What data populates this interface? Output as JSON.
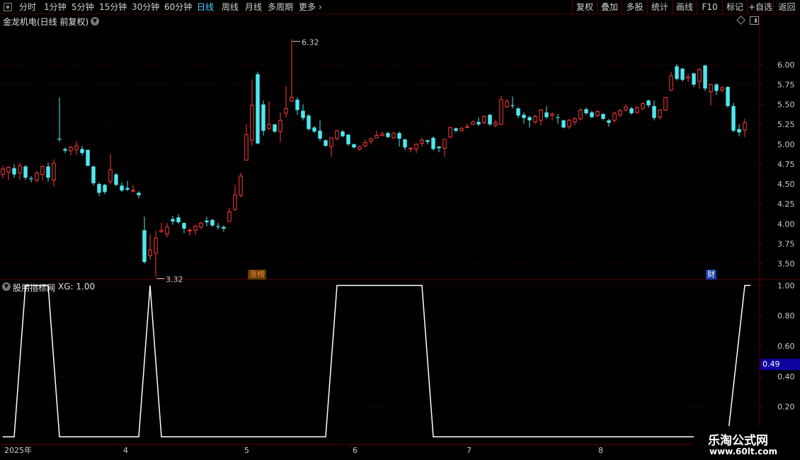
{
  "toolbar": {
    "periods": [
      "分时",
      "1分钟",
      "5分钟",
      "15分钟",
      "30分钟",
      "60分钟",
      "日线",
      "周线",
      "月线",
      "多周期",
      "更多"
    ],
    "active_period": "日线",
    "more_chevron": "chevron-right-icon",
    "right_buttons": [
      "复权",
      "叠加",
      "多股",
      "统计",
      "画线",
      "F10",
      "标记",
      "+自选",
      "返回"
    ]
  },
  "stock_title": "金龙机电(日线 前复权)",
  "indicator": {
    "name": "股朋指标网",
    "value_label": "XG: 1.00",
    "current_value": "0.49"
  },
  "badges": {
    "limit_up": "涨榜",
    "finance": "财"
  },
  "annotations": {
    "high": "6.32",
    "low": "3.32"
  },
  "watermark": {
    "name": "乐淘公式网",
    "url": "www.60lt.com"
  },
  "colors": {
    "up": "#ff3a3a",
    "down": "#4ee8f0",
    "grid": "#5a0000",
    "active_tab": "#4fd5ff",
    "indicator_line": "#ffffff"
  },
  "chart_data": [
    {
      "type": "candlestick",
      "title": "金龙机电(日线 前复权)",
      "y_ticks": [
        "6.00",
        "5.75",
        "5.50",
        "5.25",
        "5.00",
        "4.75",
        "4.50",
        "4.25",
        "4.00",
        "3.75",
        "3.50"
      ],
      "x_ticks": [
        "2025年",
        "4",
        "5",
        "6",
        "7",
        "8"
      ],
      "ylim": [
        3.3,
        6.35
      ],
      "high_label": "6.32",
      "low_label": "3.32",
      "ohlc": [
        [
          4.62,
          4.69,
          4.73,
          4.57
        ],
        [
          4.65,
          4.71,
          4.72,
          4.55
        ],
        [
          4.7,
          4.62,
          4.75,
          4.58
        ],
        [
          4.64,
          4.73,
          4.76,
          4.55
        ],
        [
          4.72,
          4.58,
          4.74,
          4.55
        ],
        [
          4.57,
          4.56,
          4.6,
          4.52
        ],
        [
          4.55,
          4.64,
          4.66,
          4.52
        ],
        [
          4.62,
          4.72,
          4.73,
          4.54
        ],
        [
          4.72,
          4.58,
          4.77,
          4.53
        ],
        [
          4.55,
          4.76,
          4.81,
          4.47
        ],
        [
          5.07,
          5.06,
          5.59,
          5.03
        ],
        [
          4.94,
          4.92,
          4.96,
          4.89
        ],
        [
          4.92,
          4.96,
          4.98,
          4.86
        ],
        [
          4.93,
          4.98,
          5.04,
          4.87
        ],
        [
          4.94,
          4.89,
          4.98,
          4.86
        ],
        [
          4.93,
          4.73,
          4.93,
          4.72
        ],
        [
          4.72,
          4.51,
          4.73,
          4.48
        ],
        [
          4.5,
          4.39,
          4.52,
          4.35
        ],
        [
          4.49,
          4.4,
          4.5,
          4.37
        ],
        [
          4.53,
          4.68,
          4.88,
          4.5
        ],
        [
          4.62,
          4.49,
          4.64,
          4.47
        ],
        [
          4.48,
          4.42,
          4.52,
          4.4
        ],
        [
          4.45,
          4.43,
          4.54,
          4.41
        ],
        [
          4.42,
          4.42,
          4.49,
          4.39
        ],
        [
          4.39,
          4.36,
          4.41,
          4.32
        ],
        [
          3.92,
          3.52,
          4.09,
          3.5
        ],
        [
          3.6,
          3.67,
          3.87,
          3.55
        ],
        [
          3.63,
          3.82,
          3.91,
          3.33
        ],
        [
          3.9,
          3.92,
          4.01,
          3.89
        ],
        [
          3.87,
          3.96,
          4.01,
          3.83
        ],
        [
          4.06,
          4.03,
          4.1,
          3.99
        ],
        [
          4.08,
          4.02,
          4.12,
          4.0
        ],
        [
          4.01,
          3.94,
          4.02,
          3.88
        ],
        [
          3.92,
          3.92,
          3.95,
          3.85
        ],
        [
          3.92,
          3.97,
          3.98,
          3.86
        ],
        [
          3.96,
          4.01,
          4.03,
          3.93
        ],
        [
          4.04,
          4.02,
          4.09,
          3.97
        ],
        [
          4.05,
          3.98,
          4.06,
          3.96
        ],
        [
          3.97,
          3.96,
          4.01,
          3.93
        ],
        [
          3.96,
          3.94,
          3.98,
          3.9
        ],
        [
          4.03,
          4.15,
          4.2,
          4.03
        ],
        [
          4.18,
          4.36,
          4.49,
          4.16
        ],
        [
          4.36,
          4.6,
          4.64,
          4.33
        ],
        [
          4.8,
          5.12,
          5.25,
          4.8
        ],
        [
          5.05,
          5.49,
          5.81,
          4.98
        ],
        [
          5.88,
          5.01,
          5.91,
          5.0
        ],
        [
          5.5,
          5.17,
          5.55,
          5.11
        ],
        [
          5.2,
          5.25,
          5.54,
          5.17
        ],
        [
          5.25,
          5.16,
          5.25,
          5.14
        ],
        [
          5.16,
          5.3,
          5.4,
          5.03
        ],
        [
          5.39,
          5.45,
          5.73,
          5.34
        ],
        [
          5.54,
          5.59,
          6.32,
          5.54
        ],
        [
          5.56,
          5.43,
          5.59,
          5.37
        ],
        [
          5.42,
          5.33,
          5.5,
          5.3
        ],
        [
          5.36,
          5.19,
          5.38,
          5.17
        ],
        [
          5.21,
          5.16,
          5.23,
          5.14
        ],
        [
          5.17,
          5.07,
          5.3,
          5.04
        ],
        [
          5.05,
          4.98,
          5.06,
          4.97
        ],
        [
          4.97,
          5.08,
          5.07,
          4.84
        ],
        [
          5.07,
          5.17,
          5.18,
          5.05
        ],
        [
          5.16,
          5.1,
          5.18,
          5.09
        ],
        [
          5.12,
          5.0,
          5.13,
          4.98
        ],
        [
          5.0,
          4.96,
          5.01,
          4.95
        ],
        [
          4.94,
          4.97,
          4.98,
          4.92
        ],
        [
          4.98,
          5.02,
          5.06,
          4.96
        ],
        [
          5.04,
          5.07,
          5.08,
          5.0
        ],
        [
          5.08,
          5.11,
          5.17,
          5.08
        ],
        [
          5.11,
          5.13,
          5.16,
          5.1
        ],
        [
          5.14,
          5.09,
          5.16,
          5.08
        ],
        [
          5.08,
          5.14,
          5.15,
          5.07
        ],
        [
          5.14,
          5.07,
          5.16,
          4.97
        ],
        [
          5.06,
          4.96,
          5.07,
          4.93
        ],
        [
          4.95,
          4.95,
          4.96,
          4.9
        ],
        [
          4.94,
          5.0,
          5.01,
          4.89
        ],
        [
          5.01,
          5.05,
          5.08,
          4.97
        ],
        [
          5.05,
          5.03,
          5.06,
          5.0
        ],
        [
          5.08,
          4.94,
          5.1,
          4.92
        ],
        [
          4.97,
          4.95,
          4.98,
          4.9
        ],
        [
          4.95,
          5.06,
          5.06,
          4.84
        ],
        [
          5.09,
          5.21,
          5.22,
          5.08
        ],
        [
          5.2,
          5.17,
          5.21,
          5.15
        ],
        [
          5.17,
          5.2,
          5.22,
          5.16
        ],
        [
          5.22,
          5.22,
          5.26,
          5.2
        ],
        [
          5.25,
          5.28,
          5.3,
          5.24
        ],
        [
          5.28,
          5.25,
          5.34,
          5.23
        ],
        [
          5.27,
          5.35,
          5.36,
          5.25
        ],
        [
          5.37,
          5.25,
          5.38,
          5.23
        ],
        [
          5.24,
          5.27,
          5.31,
          5.21
        ],
        [
          5.25,
          5.56,
          5.61,
          5.24
        ],
        [
          5.47,
          5.54,
          5.57,
          5.46
        ],
        [
          5.49,
          5.48,
          5.6,
          5.45
        ],
        [
          5.45,
          5.36,
          5.47,
          5.33
        ],
        [
          5.37,
          5.33,
          5.4,
          5.26
        ],
        [
          5.34,
          5.3,
          5.36,
          5.21
        ],
        [
          5.28,
          5.35,
          5.37,
          5.26
        ],
        [
          5.3,
          5.43,
          5.44,
          5.24
        ],
        [
          5.4,
          5.34,
          5.48,
          5.32
        ],
        [
          5.36,
          5.38,
          5.4,
          5.3
        ],
        [
          5.34,
          5.33,
          5.38,
          5.26
        ],
        [
          5.3,
          5.21,
          5.31,
          5.2
        ],
        [
          5.22,
          5.3,
          5.32,
          5.19
        ],
        [
          5.28,
          5.32,
          5.34,
          5.24
        ],
        [
          5.32,
          5.43,
          5.45,
          5.3
        ],
        [
          5.44,
          5.39,
          5.46,
          5.37
        ],
        [
          5.4,
          5.34,
          5.42,
          5.33
        ],
        [
          5.36,
          5.41,
          5.43,
          5.34
        ],
        [
          5.38,
          5.32,
          5.39,
          5.3
        ],
        [
          5.3,
          5.27,
          5.32,
          5.22
        ],
        [
          5.3,
          5.39,
          5.41,
          5.27
        ],
        [
          5.37,
          5.42,
          5.44,
          5.34
        ],
        [
          5.43,
          5.47,
          5.5,
          5.41
        ],
        [
          5.45,
          5.39,
          5.47,
          5.37
        ],
        [
          5.4,
          5.46,
          5.48,
          5.38
        ],
        [
          5.45,
          5.51,
          5.53,
          5.43
        ],
        [
          5.55,
          5.49,
          5.56,
          5.46
        ],
        [
          5.48,
          5.33,
          5.55,
          5.3
        ],
        [
          5.34,
          5.43,
          5.44,
          5.31
        ],
        [
          5.43,
          5.59,
          5.59,
          5.42
        ],
        [
          5.68,
          5.86,
          5.91,
          5.67
        ],
        [
          5.98,
          5.82,
          6.01,
          5.8
        ],
        [
          5.95,
          5.81,
          5.96,
          5.79
        ],
        [
          5.83,
          5.85,
          5.89,
          5.78
        ],
        [
          5.89,
          5.75,
          5.9,
          5.72
        ],
        [
          5.79,
          5.94,
          5.96,
          5.7
        ],
        [
          5.99,
          5.7,
          6.0,
          5.67
        ],
        [
          5.66,
          5.75,
          5.76,
          5.49
        ],
        [
          5.75,
          5.67,
          5.77,
          5.62
        ],
        [
          5.68,
          5.71,
          5.73,
          5.65
        ],
        [
          5.72,
          5.48,
          5.73,
          5.46
        ],
        [
          5.48,
          5.17,
          5.52,
          5.15
        ],
        [
          5.19,
          5.15,
          5.25,
          5.1
        ],
        [
          5.18,
          5.27,
          5.32,
          5.09
        ]
      ]
    },
    {
      "type": "line",
      "series": [
        {
          "name": "XG",
          "values": []
        }
      ],
      "y_ticks": [
        "1.00",
        "0.80",
        "0.60",
        "0.40",
        "0.20"
      ],
      "ylim": [
        -0.05,
        1.03
      ],
      "current_value": "0.49",
      "segments": [
        [
          0,
          0
        ],
        [
          2,
          0
        ],
        [
          4,
          1
        ],
        [
          8,
          1
        ],
        [
          10,
          0
        ],
        [
          24,
          0
        ],
        [
          26,
          1
        ],
        [
          28,
          0
        ],
        [
          57,
          0
        ],
        [
          59,
          1
        ],
        [
          74,
          1
        ],
        [
          76,
          0
        ],
        [
          128,
          0
        ],
        [
          131,
          1
        ],
        [
          132,
          1
        ]
      ]
    }
  ]
}
